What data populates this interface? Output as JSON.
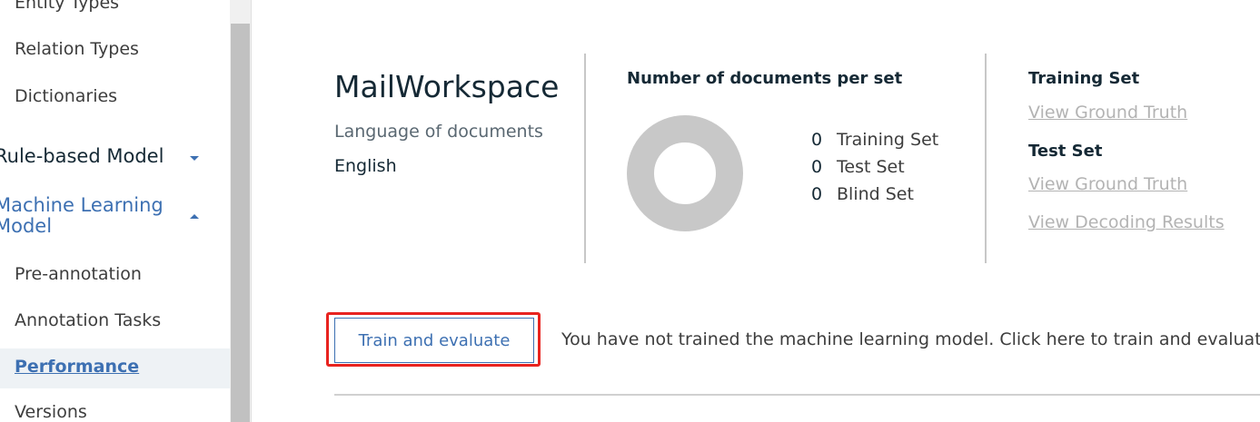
{
  "sidebar": {
    "items": [
      {
        "label": "Entity Types"
      },
      {
        "label": "Relation Types"
      },
      {
        "label": "Dictionaries"
      },
      {
        "label": "Rule-based Model"
      },
      {
        "label": "Machine Learning Model"
      },
      {
        "label": "Pre-annotation"
      },
      {
        "label": "Annotation Tasks"
      },
      {
        "label": "Performance",
        "active": true
      },
      {
        "label": "Versions"
      }
    ],
    "ml_line1": "Machine Learning",
    "ml_line2": "Model"
  },
  "workspace": {
    "name": "MailWorkspace",
    "language_label": "Language of documents",
    "language_value": "English"
  },
  "chart_data": {
    "type": "pie",
    "title": "Number of documents per set",
    "categories": [
      "Training Set",
      "Test Set",
      "Blind Set"
    ],
    "values": [
      0,
      0,
      0
    ],
    "empty_color": "#c8c8c8"
  },
  "sets": {
    "training_title": "Training Set",
    "training_link": "View Ground Truth",
    "test_title": "Test Set",
    "test_link": "View Ground Truth",
    "decoding_link": "View Decoding Results"
  },
  "train": {
    "button_label": "Train and evaluate",
    "message": "You have not trained the machine learning model. Click here to train and evaluate i"
  },
  "colors": {
    "accent": "#3d70b2",
    "highlight": "#e8231f"
  }
}
